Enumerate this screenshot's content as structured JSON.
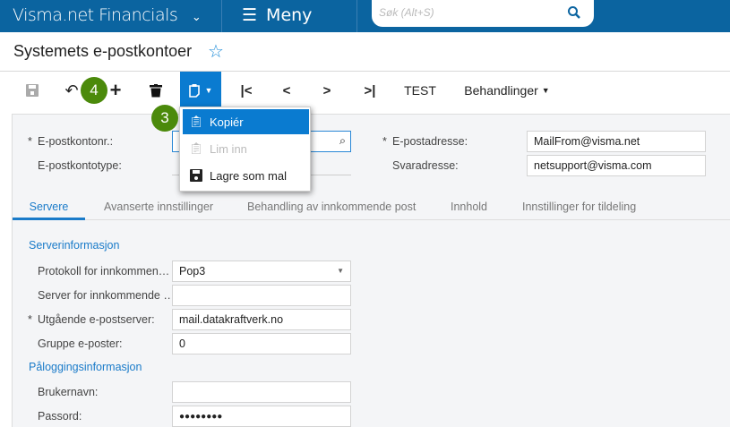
{
  "topbar": {
    "app_name": "Visma.net Financials",
    "menu_label": "Meny",
    "search_placeholder": "Søk (Alt+S)"
  },
  "page": {
    "title": "Systemets e-postkontoer"
  },
  "toolbar": {
    "test_label": "TEST",
    "actions_label": "Behandlinger"
  },
  "copy_menu": {
    "items": [
      {
        "label": "Kopiér"
      },
      {
        "label": "Lim inn"
      },
      {
        "label": "Lagre som mal"
      }
    ]
  },
  "badges": {
    "undo": "4",
    "copy": "3"
  },
  "header_form": {
    "account_no_label": "E-postkontonr.:",
    "account_type_label": "E-postkontotype:",
    "email_label": "E-postadresse:",
    "email_value": "MailFrom@visma.net",
    "reply_label": "Svaradresse:",
    "reply_value": "netsupport@visma.com"
  },
  "tabs": [
    {
      "label": "Servere"
    },
    {
      "label": "Avanserte innstillinger"
    },
    {
      "label": "Behandling av innkommende post"
    },
    {
      "label": "Innhold"
    },
    {
      "label": "Innstillinger for tildeling"
    }
  ],
  "servers": {
    "server_section": "Serverinformasjon",
    "protocol_label": "Protokoll for innkommen…",
    "protocol_value": "Pop3",
    "incoming_label": "Server for innkommende …",
    "incoming_value": "",
    "outgoing_label": "Utgående e-postserver:",
    "outgoing_value": "mail.datakraftverk.no",
    "group_label": "Gruppe e-poster:",
    "group_value": "0",
    "login_section": "Påloggingsinformasjon",
    "username_label": "Brukernavn:",
    "username_value": "",
    "password_label": "Passord:",
    "password_value": "●●●●●●●●"
  },
  "colors": {
    "brand": "#0b64a0",
    "accent": "#0a7bd0",
    "badge": "#4b8a0b"
  }
}
